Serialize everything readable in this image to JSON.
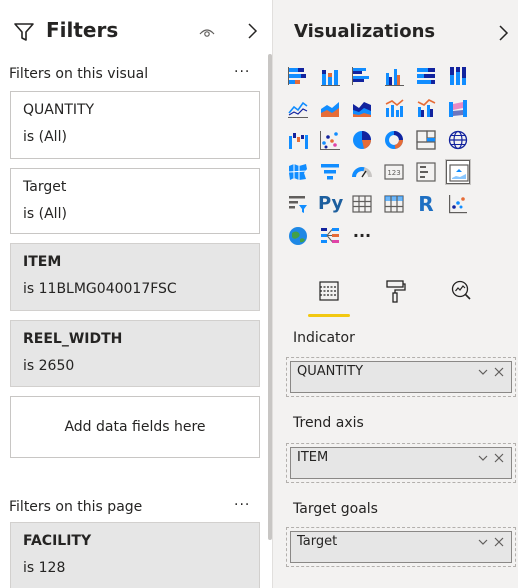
{
  "filters_pane": {
    "title": "Filters",
    "icons": [
      "filter-funnel-icon",
      "eye-icon",
      "chevron-right-icon"
    ],
    "visual_section": {
      "label": "Filters on this visual",
      "more": "···",
      "cards": [
        {
          "name": "QUANTITY",
          "value": "is (All)",
          "style": "outline"
        },
        {
          "name": "Target",
          "value": "is (All)",
          "style": "outline"
        },
        {
          "name": "ITEM",
          "value": "is 11BLMG040017FSC",
          "style": "filled"
        },
        {
          "name": "REEL_WIDTH",
          "value": "is 2650",
          "style": "filled"
        }
      ],
      "add_placeholder": "Add data fields here"
    },
    "page_section": {
      "label": "Filters on this page",
      "more": "···",
      "cards": [
        {
          "name": "FACILITY",
          "value": "is 128",
          "style": "filled"
        }
      ]
    }
  },
  "visualizations_pane": {
    "title": "Visualizations",
    "chevron": "chevron-right-icon",
    "gallery_more": "···",
    "python_label": "Py",
    "r_label": "R",
    "selected_visual": "kpi-visual-icon",
    "tabs": [
      "fields-tab-icon",
      "format-paintroller-icon",
      "analytics-magnifier-icon"
    ],
    "active_tab": "fields-tab-icon",
    "wells": [
      {
        "label": "Indicator",
        "field": "QUANTITY"
      },
      {
        "label": "Trend axis",
        "field": "ITEM"
      },
      {
        "label": "Target goals",
        "field": "Target"
      }
    ]
  },
  "colors": {
    "accent_yellow": "#f2c811",
    "card_gray": "#e6e6e6",
    "pane_bg": "#f3f2f1",
    "viz_blue": "#118dff",
    "viz_navy": "#12239e",
    "viz_orange": "#e66c37",
    "viz_pink": "#e044a7"
  }
}
